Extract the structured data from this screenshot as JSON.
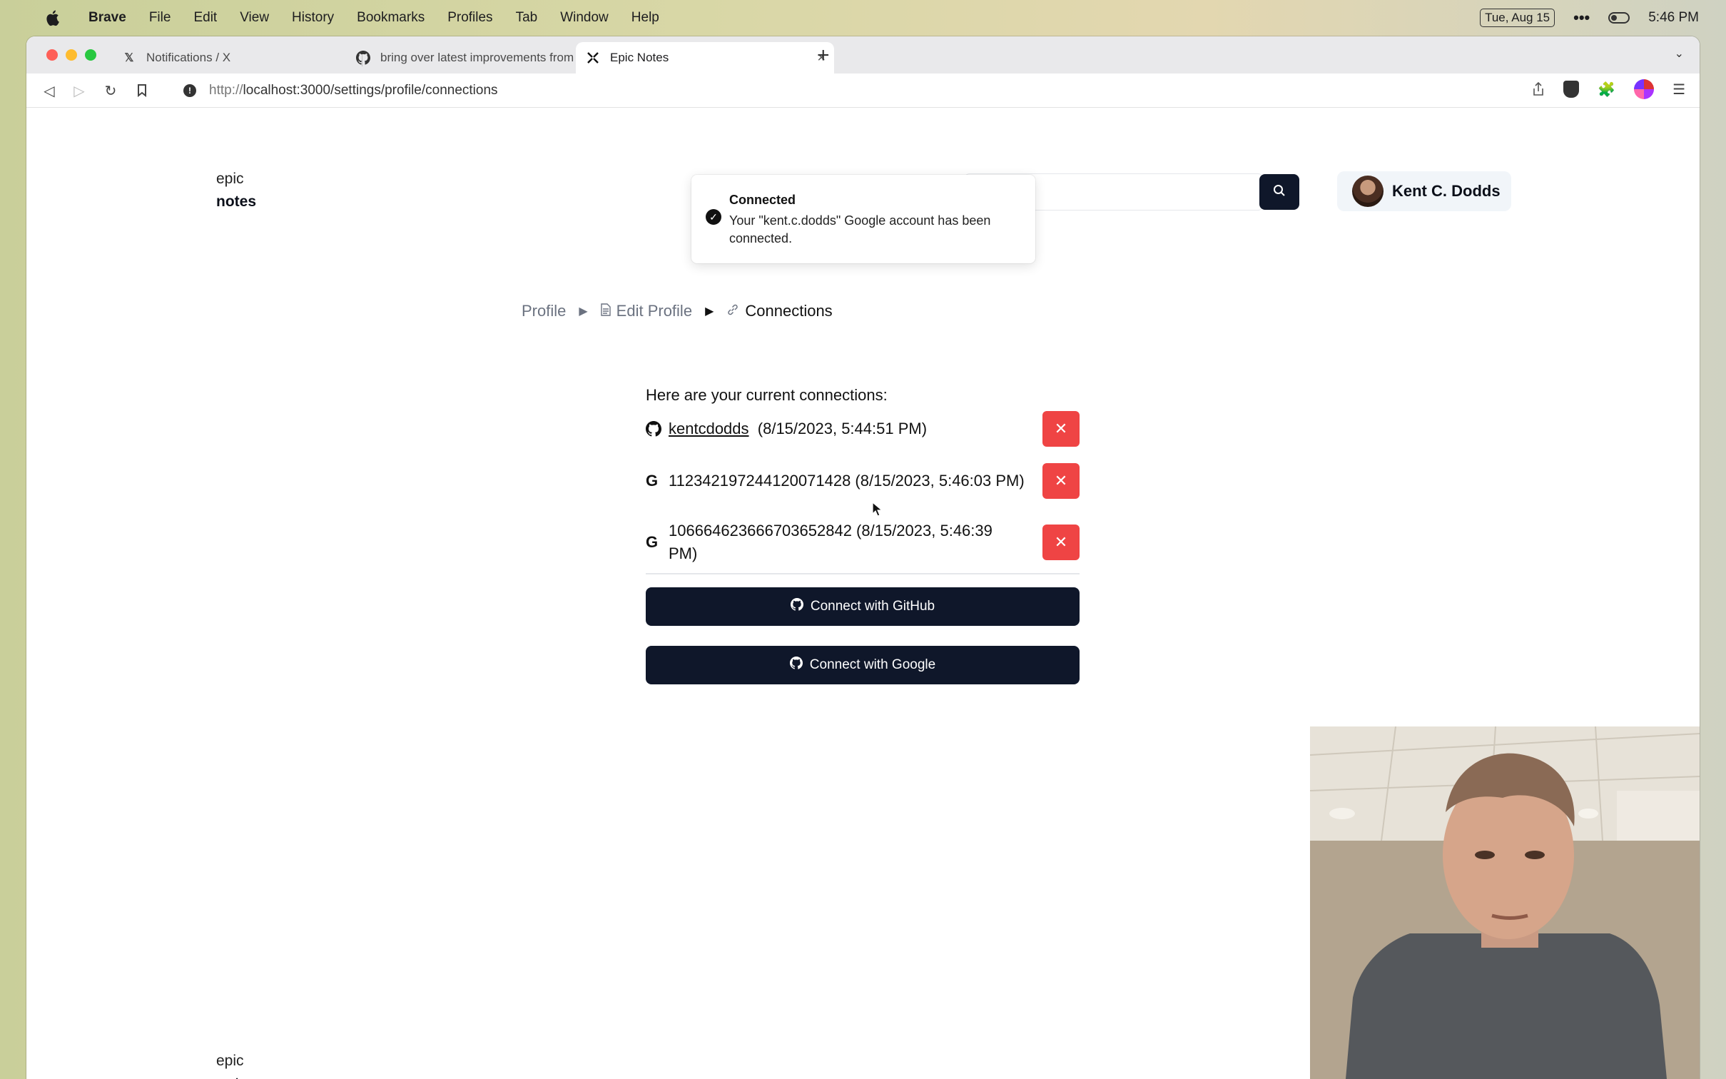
{
  "menubar": {
    "app": "Brave",
    "items": [
      "File",
      "Edit",
      "View",
      "History",
      "Bookmarks",
      "Profiles",
      "Tab",
      "Window",
      "Help"
    ],
    "date": "Tue, Aug 15",
    "time": "5:46 PM"
  },
  "tabs": [
    {
      "title": "Notifications / X",
      "icon": "x-logo-icon"
    },
    {
      "title": "bring over latest improvements from",
      "icon": "github-icon"
    },
    {
      "title": "Epic Notes",
      "icon": "epic-notes-icon"
    }
  ],
  "address": {
    "protocol": "http://",
    "rest": "localhost:3000/settings/profile/connections"
  },
  "logo": {
    "line1": "epic",
    "line2": "notes"
  },
  "user": {
    "name": "Kent C. Dodds"
  },
  "toast": {
    "title": "Connected",
    "message": "Your \"kent.c.dodds\" Google account has been connected."
  },
  "breadcrumb": {
    "profile": "Profile",
    "edit_profile": "Edit Profile",
    "connections": "Connections"
  },
  "connections": {
    "heading": "Here are your current connections:",
    "items": [
      {
        "provider": "github",
        "name": "kentcdodds",
        "date": "(8/15/2023, 5:44:51 PM)"
      },
      {
        "provider": "google",
        "text": "112342197244120071428 (8/15/2023, 5:46:03 PM)"
      },
      {
        "provider": "google",
        "text": "106664623666703652842 (8/15/2023, 5:46:39 PM)"
      }
    ],
    "connect_github": "Connect with GitHub",
    "connect_google": "Connect with Google"
  },
  "colors": {
    "primary": "#0f172a",
    "danger": "#ef4444"
  }
}
